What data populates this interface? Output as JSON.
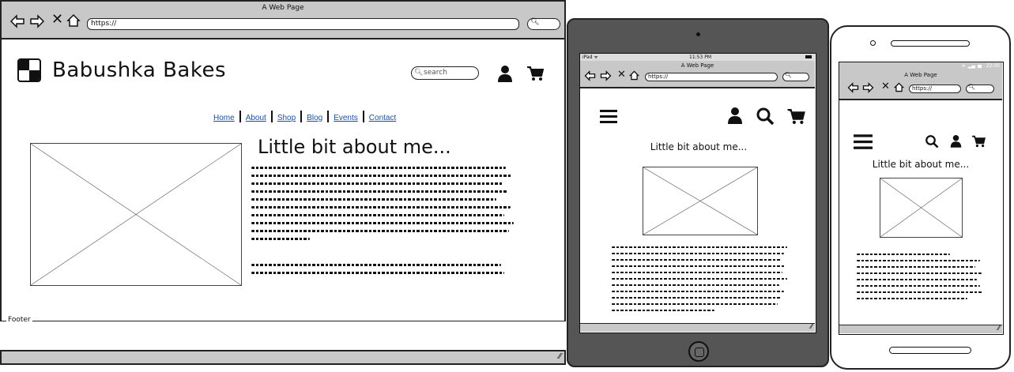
{
  "desktop": {
    "window_title": "A Web Page",
    "url": "https://",
    "brand": "Babushka Bakes",
    "search_placeholder": "search",
    "nav": [
      "Home",
      "About",
      "Shop",
      "Blog",
      "Events",
      "Contact"
    ],
    "heading": "Little bit about me...",
    "footer_label": "Footer",
    "icons": [
      "back-arrow-icon",
      "forward-arrow-icon",
      "close-icon",
      "home-icon",
      "search-icon",
      "logo-icon",
      "user-icon",
      "cart-icon",
      "resize-grip-icon"
    ]
  },
  "tablet": {
    "status_left": "iPad ᯤ",
    "status_time": "11:53 PM",
    "window_title": "A Web Page",
    "url": "https://",
    "heading": "Little bit about me...",
    "icons": [
      "hamburger-menu-icon",
      "user-icon",
      "search-icon",
      "cart-icon",
      "home-button-icon"
    ]
  },
  "phone": {
    "status_time": "22:00",
    "window_title": "A Web Page",
    "url": "https://",
    "heading": "Little bit about me...",
    "icons": [
      "hamburger-menu-icon",
      "search-icon",
      "user-icon",
      "cart-icon"
    ]
  }
}
